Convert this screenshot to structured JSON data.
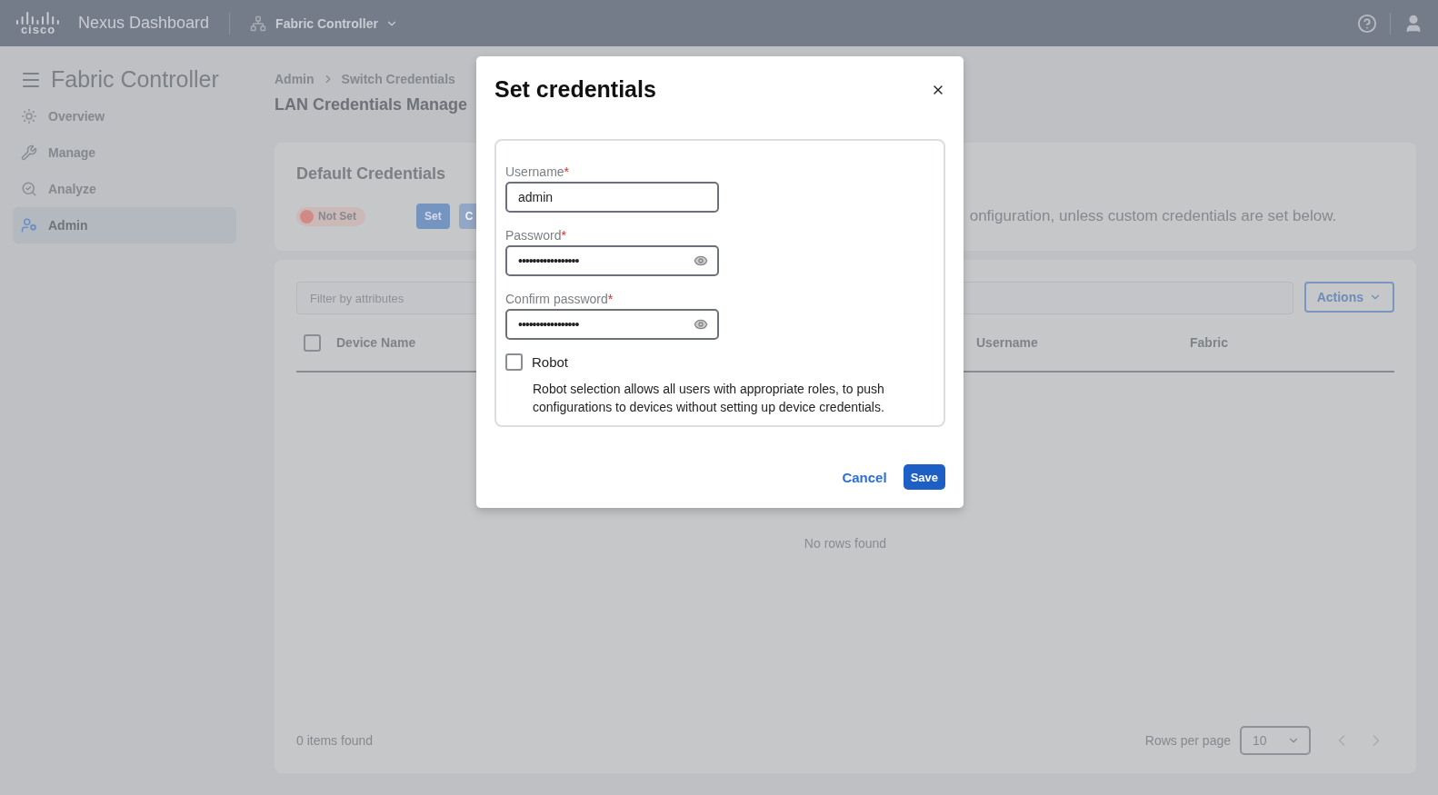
{
  "topbar": {
    "logo_text": "cisco",
    "product": "Nexus Dashboard",
    "app": "Fabric Controller"
  },
  "sidebar": {
    "title": "Fabric Controller",
    "items": [
      {
        "label": "Overview",
        "selected": false
      },
      {
        "label": "Manage",
        "selected": false
      },
      {
        "label": "Analyze",
        "selected": false
      },
      {
        "label": "Admin",
        "selected": true
      }
    ]
  },
  "breadcrumb": [
    "Admin",
    "Switch Credentials"
  ],
  "page_title": "LAN Credentials Manage",
  "default_credentials": {
    "title": "Default Credentials",
    "status": {
      "label": "Not Set",
      "color": "#d08a86"
    },
    "buttons": [
      {
        "label": "Set",
        "disabled": false
      },
      {
        "label": "C",
        "disabled": true
      }
    ],
    "description": "onfiguration, unless custom credentials are set below."
  },
  "table": {
    "filter_placeholder": "Filter by attributes",
    "actions": "Actions",
    "select_all_checked": false,
    "columns": [
      "Device Name",
      "Username",
      "Fabric"
    ],
    "empty": "No rows found",
    "count": "0 items found",
    "rows_per_page_label": "Rows per page",
    "rows_per_page": "10"
  },
  "dialog": {
    "title": "Set credentials",
    "fields": [
      {
        "label": "Username",
        "required_mark": "*",
        "kind": "text",
        "value": "admin"
      },
      {
        "label": "Password",
        "required_mark": "*",
        "kind": "password",
        "value": "•••••••••••••••••"
      },
      {
        "label": "Confirm password",
        "required_mark": "*",
        "kind": "password",
        "value": "•••••••••••••••••"
      }
    ],
    "robot": {
      "label": "Robot",
      "checked": false,
      "help": "Robot selection allows all users with appropriate roles, to push configurations to devices without setting up device credentials."
    },
    "cancel": "Cancel",
    "save": "Save"
  }
}
